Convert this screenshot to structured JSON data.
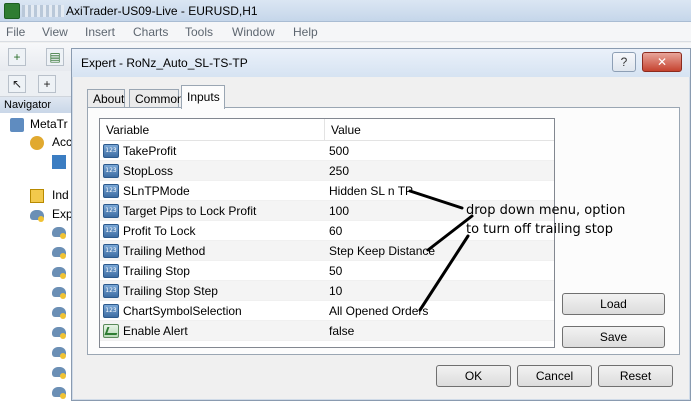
{
  "app": {
    "title": "AxiTrader-US09-Live - EURUSD,H1"
  },
  "menu": [
    "File",
    "View",
    "Insert",
    "Charts",
    "Tools",
    "Window",
    "Help"
  ],
  "navigator": {
    "title": "Navigator",
    "items": [
      "MetaTr",
      "Acc",
      "Ind",
      "Exp"
    ]
  },
  "dialog": {
    "title": "Expert - RoNz_Auto_SL-TS-TP",
    "help_label": "?",
    "close_label": "✕",
    "tabs": [
      "About",
      "Common",
      "Inputs"
    ],
    "active_tab": "Inputs",
    "columns": {
      "variable": "Variable",
      "value": "Value"
    },
    "rows": [
      {
        "variable": "TakeProfit",
        "value": "500",
        "icon": "int-icon"
      },
      {
        "variable": "StopLoss",
        "value": "250",
        "icon": "int-icon"
      },
      {
        "variable": "SLnTPMode",
        "value": "Hidden SL n TP",
        "icon": "int-icon"
      },
      {
        "variable": "Target Pips to Lock Profit",
        "value": "100",
        "icon": "int-icon"
      },
      {
        "variable": "Profit To Lock",
        "value": "60",
        "icon": "int-icon"
      },
      {
        "variable": "Trailing Method",
        "value": "Step Keep Distance",
        "icon": "int-icon"
      },
      {
        "variable": "Trailing Stop",
        "value": "50",
        "icon": "int-icon"
      },
      {
        "variable": "Trailing Stop Step",
        "value": "10",
        "icon": "int-icon"
      },
      {
        "variable": "ChartSymbolSelection",
        "value": "All Opened Orders",
        "icon": "int-icon"
      },
      {
        "variable": "Enable Alert",
        "value": "false",
        "icon": "bool-icon"
      }
    ],
    "buttons": {
      "load": "Load",
      "save": "Save",
      "ok": "OK",
      "cancel": "Cancel",
      "reset": "Reset"
    }
  },
  "annotation": {
    "line1": "drop down menu, option",
    "line2": "to turn off trailing stop"
  }
}
